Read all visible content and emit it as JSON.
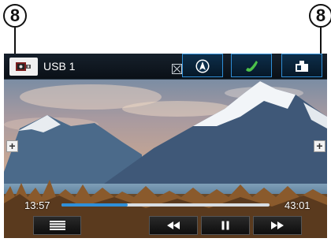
{
  "callouts": {
    "left": "8",
    "right": "8"
  },
  "header": {
    "source_label": "USB 1",
    "icons": {
      "source": "usb-media-icon",
      "status": "muted-box-icon",
      "nav": "navigation-icon",
      "phone": "phone-icon",
      "apps": "apps-icon"
    }
  },
  "side_buttons": {
    "left": "+",
    "right": "+"
  },
  "playback": {
    "elapsed": "13:57",
    "total": "43:01",
    "progress_fraction": 0.32
  },
  "controls": {
    "menu_icon": "list-menu-icon",
    "prev_icon": "rewind-icon",
    "pause_icon": "pause-icon",
    "next_icon": "fast-forward-icon"
  },
  "colors": {
    "accent": "#2f8fd8",
    "phone_green": "#4cc24a",
    "topbar": "#0a1017"
  }
}
